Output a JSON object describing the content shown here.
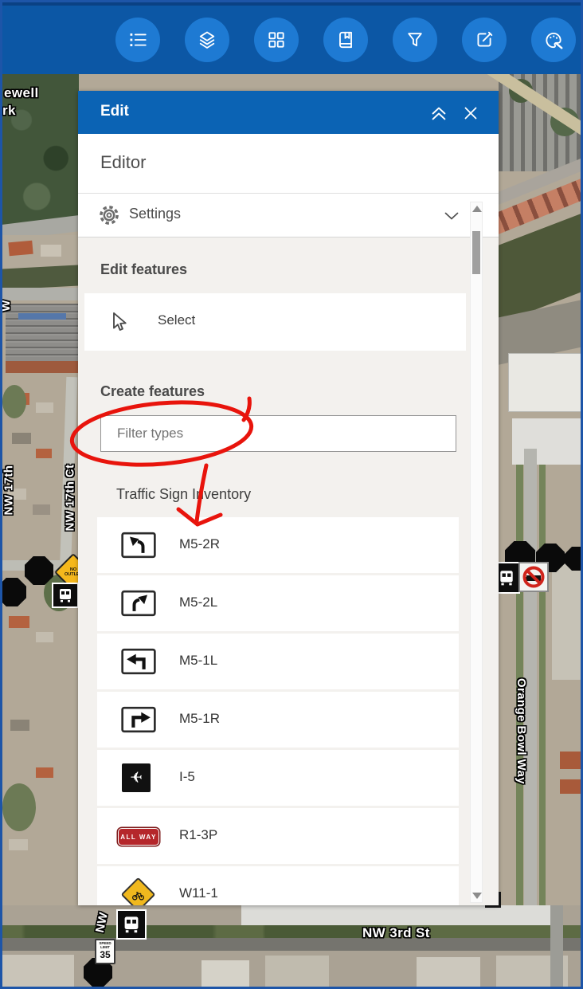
{
  "toolbar": {
    "buttons": [
      {
        "icon": "legend-icon"
      },
      {
        "icon": "layers-icon"
      },
      {
        "icon": "basemap-icon"
      },
      {
        "icon": "bookmarks-icon"
      },
      {
        "icon": "filter-icon"
      },
      {
        "icon": "edit-icon"
      },
      {
        "icon": "draw-icon"
      }
    ]
  },
  "edit_panel": {
    "header": {
      "title": "Edit"
    },
    "widget_title": "Editor",
    "settings_label": "Settings",
    "edit_features_heading": "Edit features",
    "select_label": "Select",
    "create_features_heading": "Create features",
    "filter_input": {
      "value": "",
      "placeholder": "Filter types"
    },
    "group_heading": "Traffic Sign Inventory",
    "sign_types": [
      {
        "code": "M5-2R",
        "icon": "m5-2r-sign-icon"
      },
      {
        "code": "M5-2L",
        "icon": "m5-2l-sign-icon"
      },
      {
        "code": "M5-1L",
        "icon": "m5-1l-sign-icon"
      },
      {
        "code": "M5-1R",
        "icon": "m5-1r-sign-icon"
      },
      {
        "code": "I-5",
        "icon": "i-5-sign-icon"
      },
      {
        "code": "R1-3P",
        "icon": "r1-3p-sign-icon",
        "plaque_text": "ALL WAY"
      },
      {
        "code": "W11-1",
        "icon": "w11-1-sign-icon"
      }
    ]
  },
  "map": {
    "street_labels": {
      "park_line1": "ewell",
      "park_line2": "rk",
      "w_partial": "W",
      "nw17_partial": "NW 17th",
      "nw17ct": "NW 17th Ct",
      "nw_bottom": "NW",
      "nw3rd": "NW 3rd St",
      "orange_bowl": "Orange Bowl Way"
    },
    "speed_limit_sign": {
      "line1": "SPEED",
      "line2": "LIMIT",
      "value": "35"
    },
    "no_outlet_sign": {
      "line1": "NO",
      "line2": "OUTLET"
    }
  },
  "colors": {
    "toolbar_blue": "#0c57a5",
    "toolbar_button_blue": "#1e7ad3",
    "panel_header_blue": "#0b63b4",
    "annotation_red": "#e8140c",
    "warning_yellow": "#f5b81c",
    "stop_sign_red": "#b5272b"
  }
}
